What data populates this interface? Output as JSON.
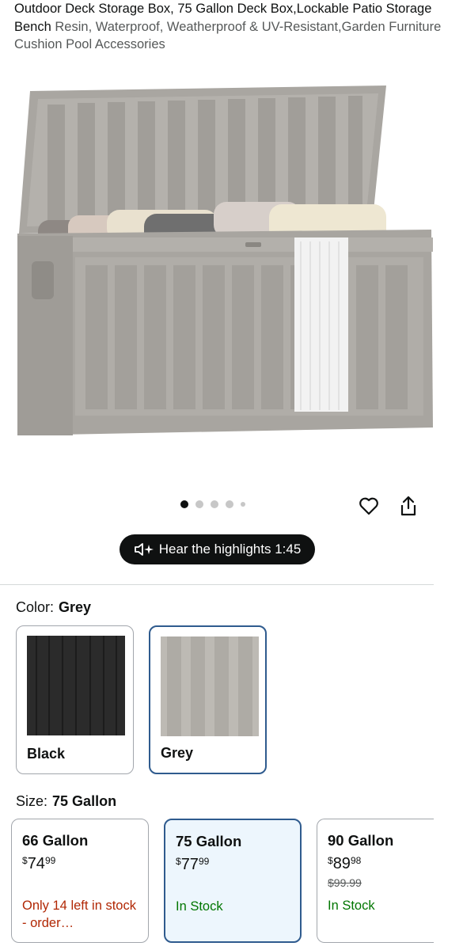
{
  "product": {
    "title": "Outdoor Deck Storage Box, 75 Gallon Deck Box,Lockable Patio Storage Bench",
    "subtitle": "Resin, Waterproof, Weatherproof & UV-Resistant,Garden Furniture Cushion Pool Accessories"
  },
  "gallery": {
    "total_dots": 5,
    "active_index": 0
  },
  "highlights": {
    "label": "Hear the highlights 1:45"
  },
  "color": {
    "label": "Color:",
    "selected": "Grey",
    "options": [
      {
        "name": "Black",
        "swatch": "#2b2b2b"
      },
      {
        "name": "Grey",
        "swatch": "#b6b3ad"
      }
    ]
  },
  "size": {
    "label": "Size:",
    "selected": "75 Gallon",
    "options": [
      {
        "name": "66 Gallon",
        "currency": "$",
        "whole": "74",
        "cents": "99",
        "list_price": "",
        "stock": "Only 14 left in stock - order…"
      },
      {
        "name": "75 Gallon",
        "currency": "$",
        "whole": "77",
        "cents": "99",
        "list_price": "",
        "stock": "In Stock"
      },
      {
        "name": "90 Gallon",
        "currency": "$",
        "whole": "89",
        "cents": "98",
        "list_price": "$99.99",
        "stock": "In Stock"
      }
    ]
  },
  "colors": {
    "accent": "#2f5b8e",
    "in_stock": "#007600",
    "low_stock": "#b12704"
  }
}
